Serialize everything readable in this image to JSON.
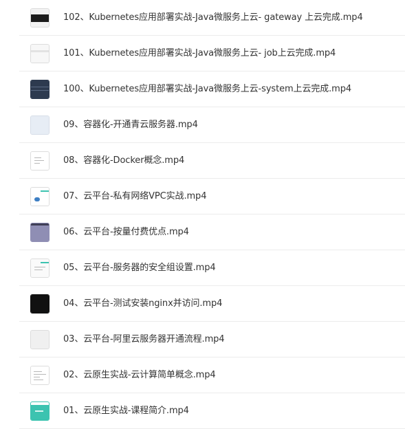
{
  "files": [
    {
      "name": "102、Kubernetes应用部署实战-Java微服务上云- gateway 上云完成.mp4",
      "thumbnail_icon": "video-thumbnail-dark-banner"
    },
    {
      "name": "101、Kubernetes应用部署实战-Java微服务上云- job上云完成.mp4",
      "thumbnail_icon": "video-thumbnail-light"
    },
    {
      "name": "100、Kubernetes应用部署实战-Java微服务上云-system上云完成.mp4",
      "thumbnail_icon": "video-thumbnail-dark-blue"
    },
    {
      "name": "09、容器化-开通青云服务器.mp4",
      "thumbnail_icon": "video-thumbnail-pale-blue"
    },
    {
      "name": "08、容器化-Docker概念.mp4",
      "thumbnail_icon": "video-thumbnail-document"
    },
    {
      "name": "07、云平台-私有网络VPC实战.mp4",
      "thumbnail_icon": "video-thumbnail-cloud-console"
    },
    {
      "name": "06、云平台-按量付费优点.mp4",
      "thumbnail_icon": "video-thumbnail-purple"
    },
    {
      "name": "05、云平台-服务器的安全组设置.mp4",
      "thumbnail_icon": "video-thumbnail-dialog"
    },
    {
      "name": "04、云平台-测试安装nginx并访问.mp4",
      "thumbnail_icon": "video-thumbnail-terminal"
    },
    {
      "name": "03、云平台-阿里云服务器开通流程.mp4",
      "thumbnail_icon": "video-thumbnail-blank"
    },
    {
      "name": "02、云原生实战-云计算简单概念.mp4",
      "thumbnail_icon": "video-thumbnail-slide"
    },
    {
      "name": "01、云原生实战-课程简介.mp4",
      "thumbnail_icon": "video-thumbnail-teal-banner"
    }
  ],
  "colors": {
    "text": "#333333",
    "divider": "#ececec",
    "teal_accent": "#3cc3b0",
    "dark_blue": "#2d3a4f",
    "purple": "#8f8eb4"
  }
}
